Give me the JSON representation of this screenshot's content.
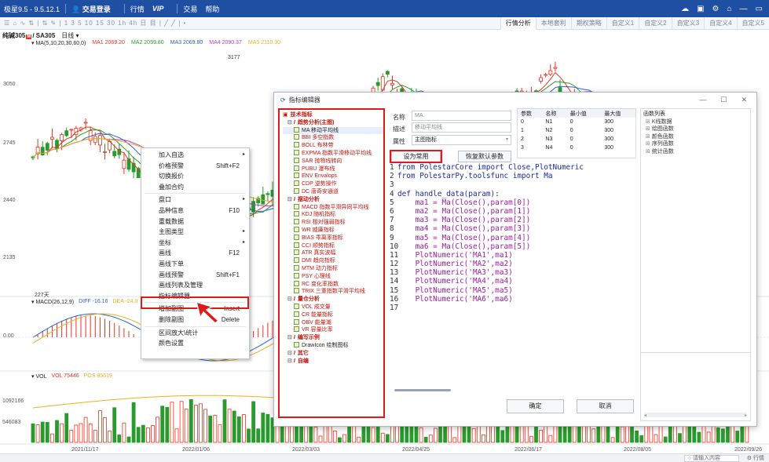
{
  "titlebar": {
    "app_title": "极星9.5 - 9.5.12.1",
    "login": "交易登录",
    "menu_quote": "行情",
    "menu_vip": "VIP",
    "menu_trade": "交易",
    "menu_help": "帮助",
    "window_controls": [
      "cloud-icon",
      "layout-icon",
      "settings-icon",
      "shirt-icon",
      "minimize-icon",
      "restore-icon"
    ]
  },
  "toolbar": {
    "tools_text": "☰ ⌂ ∿ ⇅ | ⇅ ✎ | 1 3 5 10 15 30 1h 4h 日 目 | ╱ ╱ | •",
    "tabs": [
      "行情分析",
      "本地套利",
      "期权策略",
      "自定义1",
      "自定义2",
      "自定义3",
      "自定义4",
      "自定义5"
    ]
  },
  "chart": {
    "symbol": "纯碱305",
    "symbol_badge": "M",
    "symbol_code": "/ SA305",
    "period": "日线",
    "ma_header": "MA(5,10,20,30,60,0)",
    "ma_values": [
      {
        "label": "MA1 2069.20",
        "color": "#e8331f"
      },
      {
        "label": "MA2 2059.80",
        "color": "#2b9a2e"
      },
      {
        "label": "MA3 2069.80",
        "color": "#2c63c9"
      },
      {
        "label": "MA4 2090.37",
        "color": "#b43cc8"
      },
      {
        "label": "MA5 2110.30",
        "color": "#e8b21f"
      }
    ],
    "price_labels": [
      "3050",
      "2745",
      "2440",
      "2135"
    ],
    "high_label": "3177",
    "bars_count_label": "227天",
    "macd_header": "MACD(26,12,9)",
    "macd_diff": "DIFF -16.16",
    "macd_dea": "DEA -24.0",
    "macd_zero": "0.00",
    "vol_header": "VOL",
    "vol_value": "VOL 75446",
    "vol_pos": "POS 85619",
    "vol_labels": [
      "1092166",
      "546083"
    ],
    "dates": [
      "2021/11/17",
      "2022/01/06",
      "2022/03/03",
      "2022/04/25",
      "2022/06/17",
      "2022/08/05",
      "2022/09/26"
    ],
    "colors": {
      "up": "#e8331f",
      "down": "#2b9a2e"
    }
  },
  "context_menu": {
    "items": [
      {
        "label": "加入自选",
        "shortcut": "",
        "arrow": true
      },
      {
        "label": "价格预警",
        "shortcut": "Shift+F2",
        "arrow": false
      },
      {
        "label": "切换报价",
        "shortcut": "",
        "arrow": false
      },
      {
        "label": "叠加合约",
        "shortcut": "",
        "arrow": false
      },
      {
        "divider": true
      },
      {
        "label": "盘口",
        "shortcut": "",
        "arrow": true
      },
      {
        "label": "品种信息",
        "shortcut": "F10",
        "arrow": false
      },
      {
        "label": "重载数据",
        "shortcut": "",
        "arrow": false
      },
      {
        "label": "主图类型",
        "shortcut": "",
        "arrow": true
      },
      {
        "label": "坐标",
        "shortcut": "",
        "arrow": true
      },
      {
        "label": "画线",
        "shortcut": "F12",
        "arrow": false
      },
      {
        "label": "画线下单",
        "shortcut": "",
        "arrow": false
      },
      {
        "label": "画线预警",
        "shortcut": "Shift+F1",
        "arrow": false
      },
      {
        "label": "画线列表及管理",
        "shortcut": "",
        "arrow": false
      },
      {
        "label": "指标编辑器",
        "shortcut": "",
        "arrow": false
      },
      {
        "divider": true
      },
      {
        "label": "增加副图",
        "shortcut": "Insert",
        "arrow": false
      },
      {
        "label": "删除副图",
        "shortcut": "Delete",
        "arrow": false
      },
      {
        "divider": true
      },
      {
        "label": "区间放大\\统计",
        "shortcut": "",
        "arrow": false
      },
      {
        "label": "颜色设置",
        "shortcut": "",
        "arrow": false
      }
    ]
  },
  "dialog": {
    "title": "指标编辑器",
    "tree": [
      {
        "type": "root",
        "label": "技术指标"
      },
      {
        "type": "cat",
        "label": "趋势分析(主图)"
      },
      {
        "type": "leaf",
        "label": "MA 移动平均线",
        "selected": true
      },
      {
        "type": "leaf",
        "label": "BBI 多空指数"
      },
      {
        "type": "leaf",
        "label": "BOLL 布林带"
      },
      {
        "type": "leaf",
        "label": "EXPMA 指数平滑移动平均线"
      },
      {
        "type": "leaf",
        "label": "SAR 抛物线转向"
      },
      {
        "type": "leaf",
        "label": "PUBU 瀑布线"
      },
      {
        "type": "leaf",
        "label": "ENV Envalops"
      },
      {
        "type": "leaf",
        "label": "CDP 逆势操作"
      },
      {
        "type": "leaf",
        "label": "DC 唐奇安通道"
      },
      {
        "type": "cat",
        "label": "摆动分析"
      },
      {
        "type": "leaf",
        "label": "MACD 指数平滑异同平均线"
      },
      {
        "type": "leaf",
        "label": "KDJ 随机指标"
      },
      {
        "type": "leaf",
        "label": "RSI 相对强弱指标"
      },
      {
        "type": "leaf",
        "label": "WR 威廉指标"
      },
      {
        "type": "leaf",
        "label": "BIAS 乖离率指标"
      },
      {
        "type": "leaf",
        "label": "CCI 顺势指标"
      },
      {
        "type": "leaf",
        "label": "ATR 真实波幅"
      },
      {
        "type": "leaf",
        "label": "DMI 趋向指标"
      },
      {
        "type": "leaf",
        "label": "MTM 动力指标"
      },
      {
        "type": "leaf",
        "label": "PSY 心理线"
      },
      {
        "type": "leaf",
        "label": "RC 变化率指数"
      },
      {
        "type": "leaf",
        "label": "TRIX 三重指数平滑平均线"
      },
      {
        "type": "cat",
        "label": "量仓分析"
      },
      {
        "type": "leaf",
        "label": "VOL 成交量"
      },
      {
        "type": "leaf",
        "label": "CR 能量指标"
      },
      {
        "type": "leaf",
        "label": "OBV 能量潮"
      },
      {
        "type": "leaf",
        "label": "VR 容量比率"
      },
      {
        "type": "cat",
        "label": "编写示例"
      },
      {
        "type": "leaf",
        "label": "DrawIcon 绘制图标",
        "black": true
      },
      {
        "type": "cat",
        "label": "其它"
      },
      {
        "type": "cat",
        "label": "自编"
      }
    ],
    "name_label": "名称",
    "name_value": "MA",
    "desc_label": "描述",
    "desc_value": "移动平均线",
    "attr_label": "属性",
    "attr_value": "主图指标",
    "set_common_btn": "设为常用",
    "restore_btn": "恢复默认参数",
    "params_headers": [
      "参数",
      "名称",
      "最小值",
      "最大值"
    ],
    "params_rows": [
      [
        "0",
        "N1",
        "0",
        "300"
      ],
      [
        "1",
        "N2",
        "0",
        "300"
      ],
      [
        "2",
        "N3",
        "0",
        "300"
      ],
      [
        "3",
        "N4",
        "0",
        "300"
      ]
    ],
    "func_title": "函数列表",
    "funcs": [
      "K线数据",
      "绘图函数",
      "颜色函数",
      "序列函数",
      "统计函数"
    ],
    "code_lines": [
      "from PolestarCore import Close,PlotNumeric",
      "from PolestarPy.toolsfunc import Ma",
      "",
      "def handle_data(param):",
      "    ma1 = Ma(Close(),param[0])",
      "    ma2 = Ma(Close(),param[1])",
      "    ma3 = Ma(Close(),param[2])",
      "    ma4 = Ma(Close(),param[3])",
      "    ma5 = Ma(Close(),param[4])",
      "    ma6 = Ma(Close(),param[5])",
      "    PlotNumeric('MA1',ma1)",
      "    PlotNumeric('MA2',ma2)",
      "    PlotNumeric('MA3',ma3)",
      "    PlotNumeric('MA4',ma4)",
      "    PlotNumeric('MA5',ma5)",
      "    PlotNumeric('MA6',ma6)",
      ""
    ],
    "ok_btn": "确定",
    "cancel_btn": "取消"
  },
  "statusbar": {
    "search_placeholder": "请输入内容",
    "right_text": "行情"
  }
}
